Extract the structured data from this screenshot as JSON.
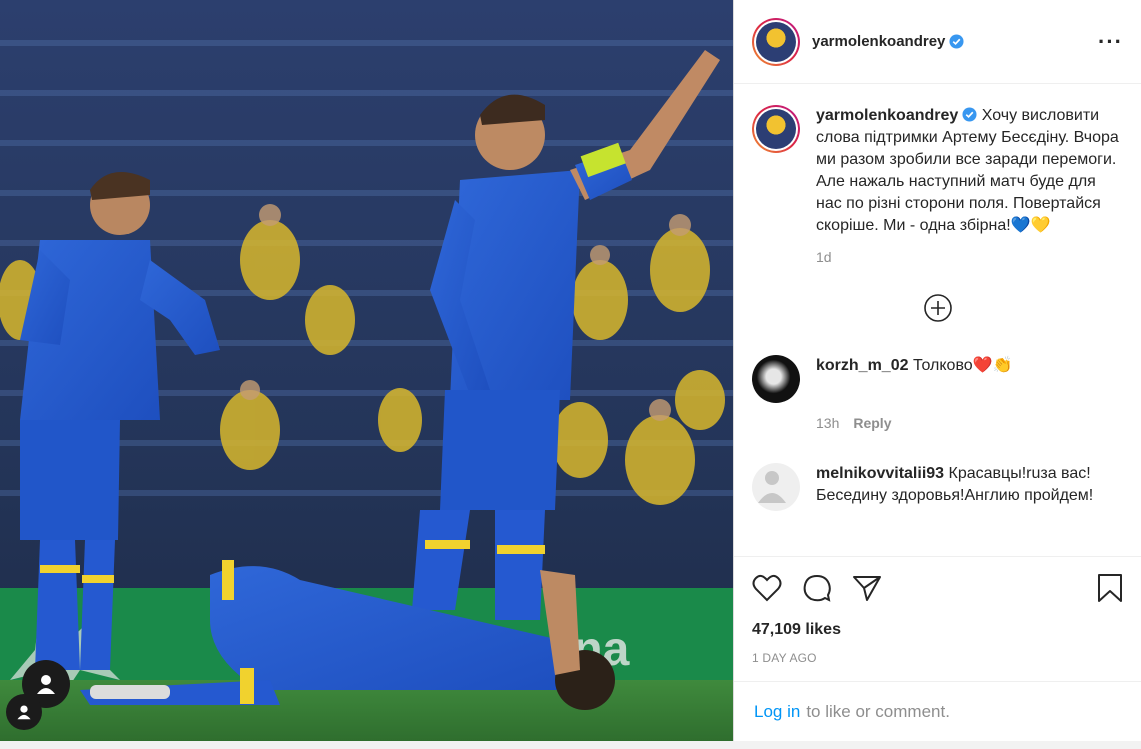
{
  "post": {
    "username": "yarmolenkoandrey",
    "caption": "Хочу висловити слова підтримки Артему Бесєдіну. Вчора ми разом зробили все заради перемоги. Але нажаль наступний матч буде для нас по різні сторони поля. Повертайся скоріше. Ми - одна збірна!💙💛",
    "caption_age": "1d",
    "likes": "47,109 likes",
    "posted_ago": "1 DAY AGO"
  },
  "comments": [
    {
      "username": "korzh_m_02",
      "text": "Толково❤️👏",
      "age": "13h",
      "reply_label": "Reply"
    },
    {
      "username": "melnikovvitalii93",
      "text": "Красавцы!ruза вас! Беседину здоровья!Англию пройдем!"
    }
  ],
  "login_bar": {
    "link": "Log in",
    "rest": "to like or comment."
  },
  "icons": {
    "more": "more-options-icon",
    "verified": "verified-badge-icon",
    "load_more": "plus-circle-icon",
    "like": "heart-icon",
    "comment": "comment-icon",
    "share": "paper-plane-icon",
    "save": "bookmark-icon"
  },
  "colors": {
    "link": "#0095f6",
    "verified": "#3897f0",
    "muted": "#8e8e8e"
  }
}
